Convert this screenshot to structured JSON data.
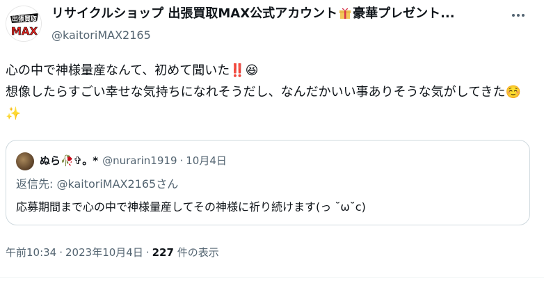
{
  "author": {
    "display_name_part1": "リサイクルショップ 出張買取MAX公式アカウント",
    "display_name_part2": "豪華プレゼント...",
    "handle": "@kaitoriMAX2165",
    "avatar_text": "出張買取",
    "avatar_logo": "MAX"
  },
  "tweet": {
    "text": "心の中で神様量産なんて、初めて聞いた‼️😆\n想像したらすごい幸せな気持ちになれそうだし、なんだかいい事ありそうな気がしてきた☺️✨"
  },
  "quote": {
    "display_name": "ぬら🥀✞。*",
    "handle": "@nurarin1919",
    "separator": "·",
    "date": "10月4日",
    "reply_prefix": "返信先: ",
    "reply_mention": "@kaitoriMAX2165",
    "reply_suffix": "さん",
    "text": "応募期間まで心の中で神様量産してその神様に祈り続けます(っ ˘ω˘c)"
  },
  "footer": {
    "time": "午前10:34",
    "separator": "·",
    "date": "2023年10月4日",
    "views_count": "227",
    "views_label": " 件の表示"
  },
  "icons": {
    "more": "more-icon",
    "gift": "gift-icon"
  },
  "colors": {
    "text": "#0f1419",
    "secondary": "#536471",
    "border": "#cfd9de",
    "logo_red": "#e0201c"
  }
}
